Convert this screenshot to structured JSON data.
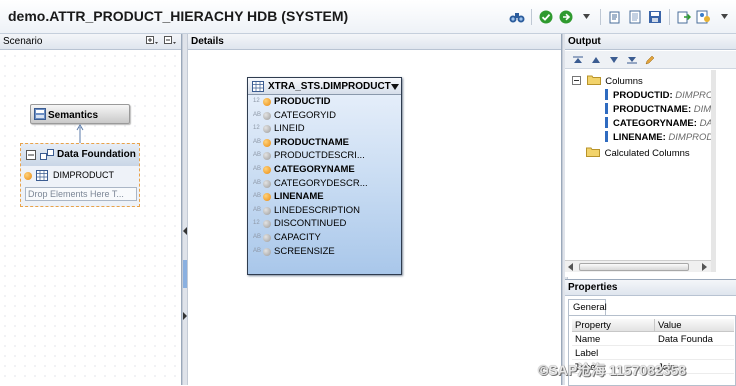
{
  "window": {
    "title": "demo.ATTR_PRODUCT_HIERACHY HDB (SYSTEM)"
  },
  "toolbar": {
    "icons": [
      "binoculars-icon",
      "activate-check-icon",
      "run-arrow-icon",
      "deploy-icon",
      "document-icon",
      "save-icon",
      "export-icon",
      "preview-icon"
    ]
  },
  "scenario": {
    "title": "Scenario",
    "semantics_label": "Semantics",
    "data_foundation_label": "Data Foundation",
    "data_foundation_item": "DIMPRODUCT",
    "drop_placeholder": "Drop Elements Here T..."
  },
  "details": {
    "title": "Details",
    "table": {
      "name": "XTRA_STS.DIMPRODUCT",
      "columns": [
        {
          "type": "12",
          "name": "PRODUCTID",
          "key": true
        },
        {
          "type": "AB",
          "name": "CATEGORYID",
          "key": false
        },
        {
          "type": "12",
          "name": "LINEID",
          "key": false
        },
        {
          "type": "AB",
          "name": "PRODUCTNAME",
          "key": true
        },
        {
          "type": "AB",
          "name": "PRODUCTDESCRI...",
          "key": false
        },
        {
          "type": "AB",
          "name": "CATEGORYNAME",
          "key": true
        },
        {
          "type": "AB",
          "name": "CATEGORYDESCR...",
          "key": false
        },
        {
          "type": "AB",
          "name": "LINENAME",
          "key": true
        },
        {
          "type": "AB",
          "name": "LINEDESCRIPTION",
          "key": false
        },
        {
          "type": "12",
          "name": "DISCONTINUED",
          "key": false
        },
        {
          "type": "AB",
          "name": "CAPACITY",
          "key": false
        },
        {
          "type": "AB",
          "name": "SCREENSIZE",
          "key": false
        }
      ]
    }
  },
  "output": {
    "title": "Output",
    "columns_folder": "Columns",
    "columns": [
      {
        "name": "PRODUCTID:",
        "source": "DIMPRO"
      },
      {
        "name": "PRODUCTNAME:",
        "source": "DIM"
      },
      {
        "name": "CATEGORYNAME:",
        "source": "DA"
      },
      {
        "name": "LINENAME:",
        "source": "DIMPROD"
      }
    ],
    "calculated_folder": "Calculated Columns"
  },
  "properties": {
    "title": "Properties",
    "tab_general": "General",
    "col_property": "Property",
    "col_value": "Value",
    "rows": [
      {
        "property": "Name",
        "value": "Data Founda"
      },
      {
        "property": "Label",
        "value": ""
      },
      {
        "property": "Type",
        "value": "Join"
      }
    ]
  },
  "watermark": "©SAP沧海 1157082358"
}
